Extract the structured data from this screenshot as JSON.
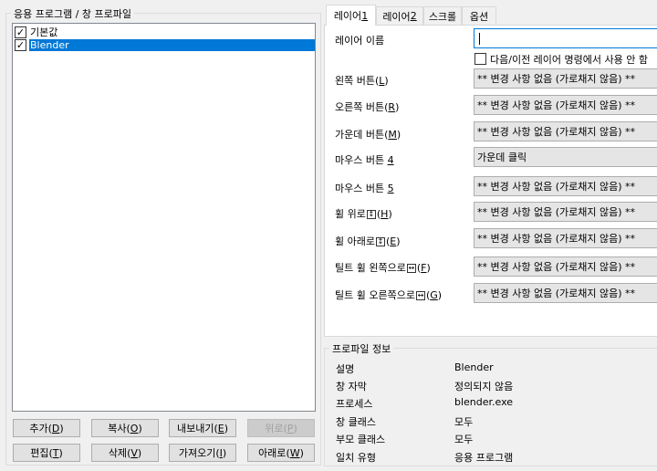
{
  "profiles_group": {
    "label": "응용 프로그램 / 창 프로파일",
    "items": [
      {
        "label": "기본값",
        "checked": true,
        "selected": false
      },
      {
        "label": "Blender",
        "checked": true,
        "selected": true
      }
    ]
  },
  "buttons": {
    "add": {
      "label": "추가",
      "key": "D"
    },
    "copy": {
      "label": "복사",
      "key": "O"
    },
    "export": {
      "label": "내보내기",
      "key": "E"
    },
    "up": {
      "label": "위로",
      "key": "P"
    },
    "edit": {
      "label": "편집",
      "key": "T"
    },
    "delete": {
      "label": "삭제",
      "key": "V"
    },
    "import": {
      "label": "가져오기",
      "key": "I"
    },
    "down": {
      "label": "아래로",
      "key": "W"
    }
  },
  "tabs": [
    {
      "label": "레이어 ",
      "num": "1",
      "active": true
    },
    {
      "label": "레이어 ",
      "num": "2",
      "active": false
    },
    {
      "label": "스크롤",
      "num": "",
      "active": false
    },
    {
      "label": "옵션",
      "num": "",
      "active": false
    }
  ],
  "layer_panel": {
    "layer_name_label": "레이어 이름",
    "layer_name_value": "",
    "skip_checkbox_label": "다음/이전 레이어 명령에서 사용 안 함",
    "rows": [
      {
        "label": "왼쪽 버튼",
        "key": "L",
        "suffix": "",
        "value": "** 변경 사항 없음 (가로채지 않음) **"
      },
      {
        "label": "오른쪽 버튼",
        "key": "R",
        "suffix": "",
        "value": "** 변경 사항 없음 (가로채지 않음) **"
      },
      {
        "label": "가운데 버튼",
        "key": "M",
        "suffix": "",
        "value": "** 변경 사항 없음 (가로채지 않음) **"
      },
      {
        "label": "마우스 버튼 ",
        "key": "4",
        "suffix": "",
        "value": "가운데 클릭"
      },
      {
        "label": "마우스 버튼 ",
        "key": "5",
        "suffix": "",
        "value": "** 변경 사항 없음 (가로채지 않음) **"
      },
      {
        "label": "휠 위로",
        "key": "H",
        "glyph": "↕",
        "value": "** 변경 사항 없음 (가로채지 않음) **"
      },
      {
        "label": "휠 아래로",
        "key": "E",
        "glyph": "↕",
        "value": "** 변경 사항 없음 (가로채지 않음) **"
      },
      {
        "label": "틸트 휠 왼쪽으로",
        "key": "F",
        "glyph": "↔",
        "value": "** 변경 사항 없음 (가로채지 않음) **"
      },
      {
        "label": "틸트 휠 오른쪽으로",
        "key": "G",
        "glyph": "↔",
        "value": "** 변경 사항 없음 (가로채지 않음) **"
      }
    ]
  },
  "profile_info": {
    "label": "프로파일 정보",
    "rows": [
      {
        "key": "설명",
        "value": "Blender"
      },
      {
        "key": "창 자막",
        "value": "정의되지 않음"
      },
      {
        "key": "프로세스",
        "value": "blender.exe"
      },
      {
        "key": "창 클래스",
        "value": "모두"
      },
      {
        "key": "부모 클래스",
        "value": "모두"
      },
      {
        "key": "일치 유형",
        "value": "응용 프로그램"
      }
    ]
  },
  "colors": {
    "selection": "#0078d7",
    "window_bg": "#f0f0f0"
  }
}
